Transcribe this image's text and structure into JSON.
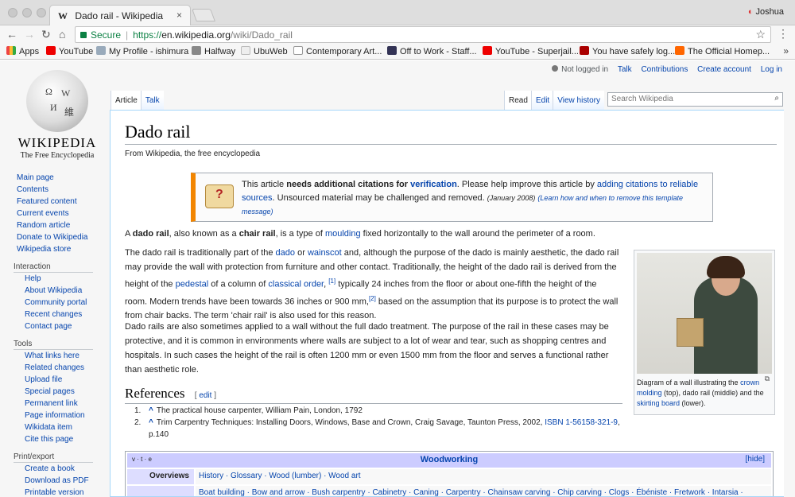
{
  "browser": {
    "tab_title": "Dado rail - Wikipedia",
    "tab_favicon": "W",
    "tab_close": "×",
    "profile_name": "Joshua",
    "secure_label": "Secure",
    "url_scheme": "https://",
    "url_host": "en.wikipedia.org",
    "url_path": "/wiki/Dado_rail",
    "bookmarks": [
      "Apps",
      "YouTube",
      "My Profile - ishimura",
      "Halfway",
      "UbuWeb",
      "Contemporary Art...",
      "Off to Work - Staff...",
      "YouTube - Superjail...",
      "You have safely log...",
      "The Official Homep..."
    ],
    "bookmarks_more": "»"
  },
  "wiki": {
    "wordmark": "WIKIPEDIA",
    "tagline": "The Free Encyclopedia",
    "personal": {
      "not_logged_in": "Not logged in",
      "talk": "Talk",
      "contributions": "Contributions",
      "create_account": "Create account",
      "login": "Log in"
    },
    "tabs_left": [
      "Article",
      "Talk"
    ],
    "tabs_right": [
      "Read",
      "Edit",
      "View history"
    ],
    "search_placeholder": "Search Wikipedia",
    "sidebar_main": [
      "Main page",
      "Contents",
      "Featured content",
      "Current events",
      "Random article",
      "Donate to Wikipedia",
      "Wikipedia store"
    ],
    "interaction_heading": "Interaction",
    "interaction_links": [
      "Help",
      "About Wikipedia",
      "Community portal",
      "Recent changes",
      "Contact page"
    ],
    "tools_heading": "Tools",
    "tools_links": [
      "What links here",
      "Related changes",
      "Upload file",
      "Special pages",
      "Permanent link",
      "Page information",
      "Wikidata item",
      "Cite this page"
    ],
    "print_heading": "Print/export",
    "print_links": [
      "Create a book",
      "Download as PDF",
      "Printable version"
    ]
  },
  "article": {
    "title": "Dado rail",
    "site_sub": "From Wikipedia, the free encyclopedia",
    "ambox": {
      "t1": "This article ",
      "t2": "needs additional citations for ",
      "t3": "verification",
      "t4": ". Please help improve this article by ",
      "t5": "adding citations to reliable sources",
      "t6": ". Unsourced material may be challenged and removed.",
      "t7": "(January 2008)",
      "t8": "(Learn how and when to remove this template message)"
    },
    "p1": {
      "a": "A ",
      "b": "dado rail",
      "c": ", also known as a ",
      "d": "chair rail",
      "e": ", is a type of ",
      "link": "moulding",
      "f": " fixed horizontally to the wall around the perimeter of a room."
    },
    "p2": {
      "a": "The dado rail is traditionally part of the ",
      "l1": "dado",
      "b": " or ",
      "l2": "wainscot",
      "c": " and, although the purpose of the dado is mainly aesthetic, the dado rail may provide the wall with protection from furniture and other contact. Traditionally, the height of the dado rail is derived from the height of the ",
      "l3": "pedestal",
      "d": " of a column of ",
      "l4": "classical order",
      "e": ", ",
      "s1": "[1]",
      "f": " typically 24 inches from the floor or about one-fifth the height of the room. Modern trends have been towards 36 inches or 900 mm,",
      "s2": "[2]",
      "g": " based on the assumption that its purpose is to protect the wall from chair backs. The term 'chair rail' is also used for this reason."
    },
    "p3": "Dado rails are also sometimes applied to a wall without the full dado treatment. The purpose of the rail in these cases may be protective, and it is common in environments where walls are subject to a lot of wear and tear, such as shopping centres and hospitals. In such cases the height of the rail is often 1200 mm or even 1500 mm from the floor and serves a functional rather than aesthetic role.",
    "thumb_caption": {
      "a": "Diagram of a wall illustrating the ",
      "l1": "crown molding",
      "b": " (top), dado rail (middle) and the ",
      "l2": "skirting board",
      "c": " (lower)."
    },
    "references_heading": "References",
    "references_edit": "edit",
    "references": [
      {
        "num": "1.",
        "caret": "^",
        "text": "The practical house carpenter, William Pain, London, 1792",
        "link": ""
      },
      {
        "num": "2.",
        "caret": "^",
        "text": "Trim Carpentry Techniques: Installing Doors, Windows, Base and Crown, Craig Savage, Taunton Press, 2002, ",
        "link": "ISBN 1-56158-321-9",
        "tail": ", p.140"
      }
    ],
    "navbox": {
      "vte": "v · t · e",
      "title": "Woodworking",
      "hide": "[hide]",
      "overviews_label": "Overviews",
      "overviews": "History · Glossary · Wood (lumber) · Wood art",
      "row2": "Boat building · Bow and arrow · Bush carpentry · Cabinetry · Caning · Carpentry · Chainsaw carving · Chip carving · Clogs · Ébéniste · Fretwork · Intarsia ·"
    }
  }
}
